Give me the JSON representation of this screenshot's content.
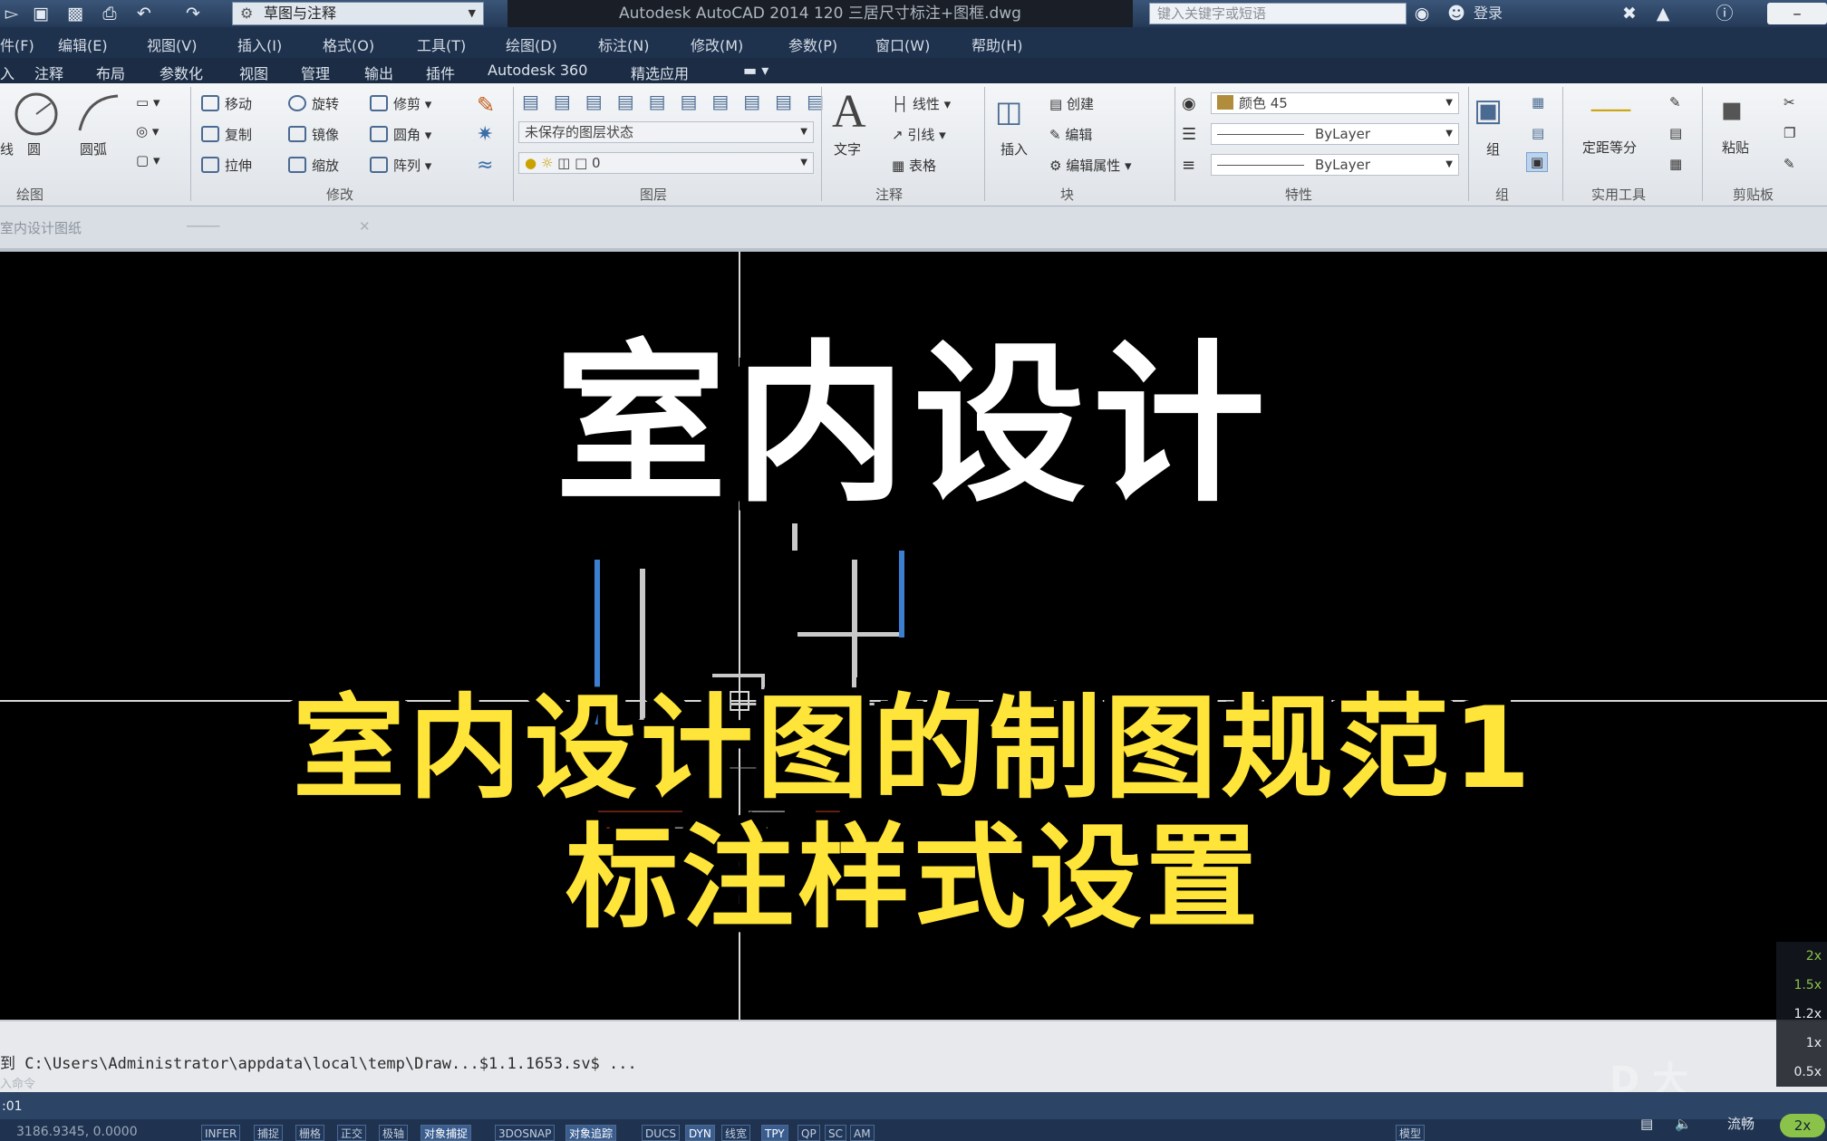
{
  "title_bar": {
    "workspace": "草图与注释",
    "title": "Autodesk AutoCAD 2014    120 三居尺寸标注+图框.dwg",
    "search_placeholder": "键入关键字或短语",
    "login": "登录"
  },
  "menu": [
    "件(F)",
    "编辑(E)",
    "视图(V)",
    "插入(I)",
    "格式(O)",
    "工具(T)",
    "绘图(D)",
    "标注(N)",
    "修改(M)",
    "参数(P)",
    "窗口(W)",
    "帮助(H)"
  ],
  "ribbon_tabs": [
    "入",
    "注释",
    "布局",
    "参数化",
    "视图",
    "管理",
    "输出",
    "插件",
    "Autodesk 360",
    "精选应用"
  ],
  "ribbon": {
    "draw": {
      "line_label": "线",
      "circle_label": "圆",
      "arc_label": "圆弧",
      "title": "绘图"
    },
    "modify": {
      "move": "移动",
      "rotate": "旋转",
      "trim": "修剪",
      "copy": "复制",
      "mirror": "镜像",
      "fillet": "圆角",
      "stretch": "拉伸",
      "scale": "缩放",
      "array": "阵列",
      "title": "修改"
    },
    "layers": {
      "state": "未保存的图层状态",
      "layer": "0",
      "title": "图层"
    },
    "annotation": {
      "text": "文字",
      "linear": "线性",
      "leader": "引线",
      "table": "表格",
      "title": "注释"
    },
    "block": {
      "insert": "插入",
      "create": "创建",
      "edit": "编辑",
      "edit_attr": "编辑属性",
      "title": "块"
    },
    "properties": {
      "color": "颜色 45",
      "linetype": "ByLayer",
      "lineweight": "ByLayer",
      "title": "特性"
    },
    "groups": {
      "group": "组",
      "title": "组"
    },
    "utilities": {
      "measure": "定距等分",
      "title": "实用工具"
    },
    "clipboard": {
      "paste": "粘贴",
      "title": "剪贴板"
    }
  },
  "doc_tabs": [
    "室内设计图纸"
  ],
  "overlay": {
    "headline": "室内设计",
    "subtitle_line1": "室内设计图的制图规范1",
    "subtitle_line2": "标注样式设置"
  },
  "command_line": {
    "text": "到 C:\\Users\\Administrator\\appdata\\local\\temp\\Draw...$1.1.1653.sv$ ...",
    "prompt": "入命令"
  },
  "status_bar": {
    "time": ":01",
    "coordinates": "3186.9345, 0.0000",
    "buttons": [
      "INFER",
      "捕捉",
      "栅格",
      "正交",
      "极轴",
      "对象捕捉",
      "3DOSNAP",
      "对象追踪",
      "DUCS",
      "DYN",
      "线宽",
      "TPY",
      "QP",
      "SC",
      "AM"
    ],
    "model": "模型"
  },
  "player": {
    "speeds": [
      "2x",
      "1.5x",
      "1.2x",
      "1x",
      "0.5x"
    ],
    "quality": "流畅",
    "current_speed": "2x",
    "watermark": "D 大"
  }
}
